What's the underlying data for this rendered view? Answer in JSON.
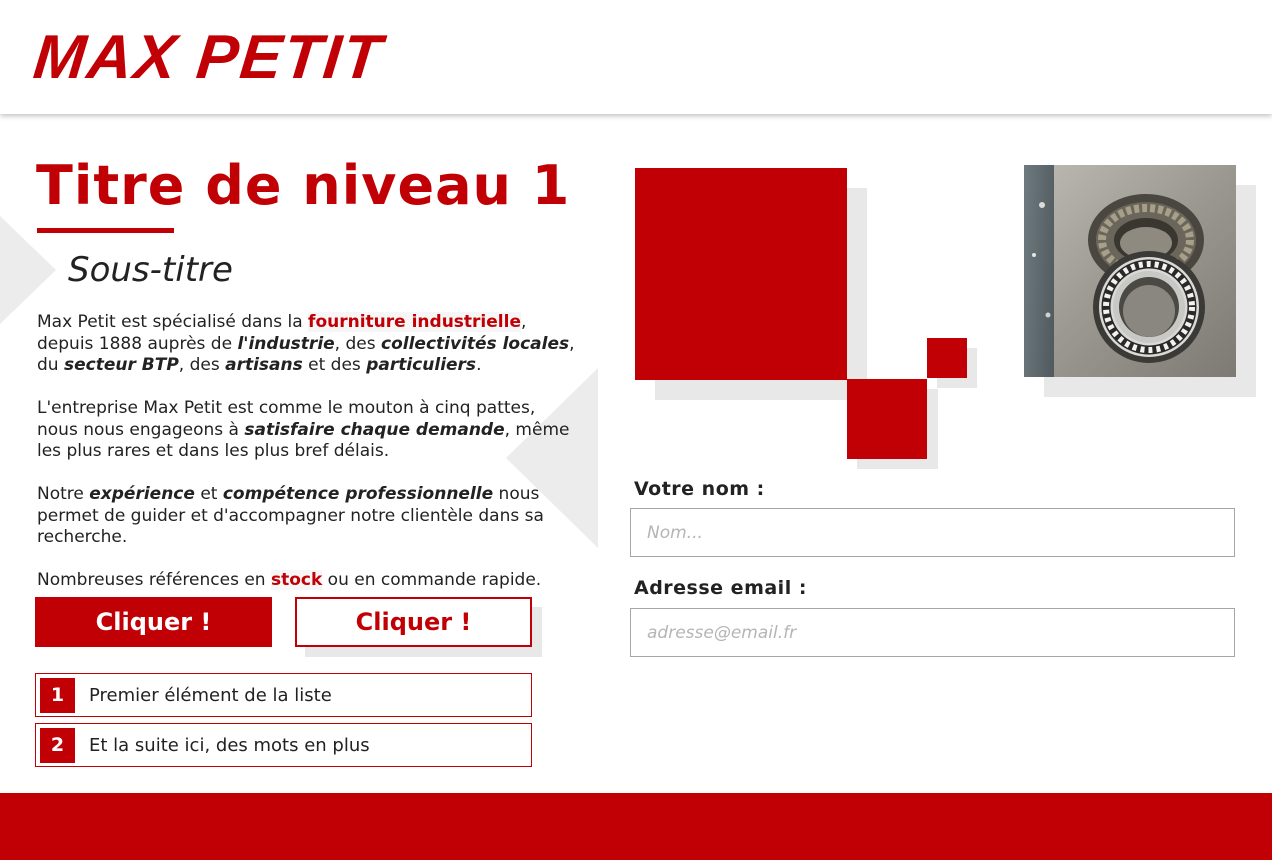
{
  "brand": {
    "name": "MAX PETIT",
    "accent": "#c10006"
  },
  "hero": {
    "title": "Titre de niveau 1",
    "subtitle": "Sous-titre"
  },
  "paragraphs": {
    "p1": {
      "t1": "Max Petit est spécialisé dans la ",
      "hl1": "fourniture industrielle",
      "t2": ", depuis 1888 auprès de ",
      "em1": "l'industrie",
      "t3": ", des ",
      "em2": "collectivités locales",
      "t4": ", du ",
      "em3": "secteur BTP",
      "t5": ", des ",
      "em4": "artisans",
      "t6": " et des ",
      "em5": "particuliers",
      "t7": "."
    },
    "p2": {
      "t1": "L'entreprise Max Petit est comme le mouton à cinq pattes, nous nous engageons à ",
      "em1": "satisfaire chaque demande",
      "t2": ", même les plus rares et dans les plus bref délais."
    },
    "p3": {
      "t1": "Notre ",
      "em1": "expérience",
      "t2": " et ",
      "em2": "compétence professionnelle",
      "t3": " nous permet de guider et d'accompagner notre clientèle dans sa recherche."
    },
    "p4": {
      "t1": "Nombreuses références en ",
      "hl1": "stock",
      "t2": " ou en commande rapide."
    }
  },
  "buttons": {
    "primary_label": "Cliquer !",
    "secondary_label": "Cliquer !"
  },
  "list": [
    {
      "num": "1",
      "text": "Premier élément de la liste"
    },
    {
      "num": "2",
      "text": "Et la suite ici, des mots en plus"
    }
  ],
  "form": {
    "name_label": "Votre nom :",
    "name_placeholder": "Nom...",
    "email_label": "Adresse email :",
    "email_placeholder": "adresse@email.fr"
  }
}
